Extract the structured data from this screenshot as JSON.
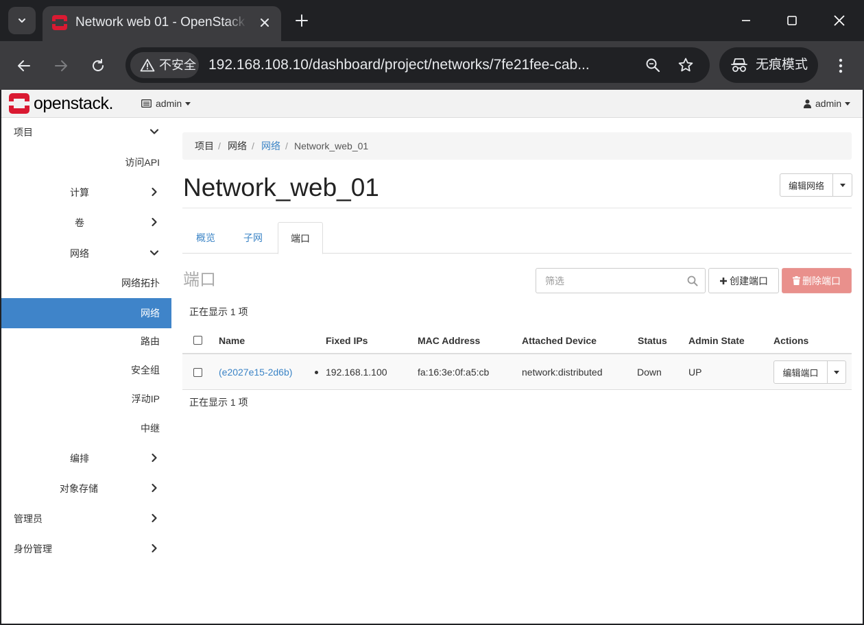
{
  "browser": {
    "tab_title": "Network web 01 - OpenStack",
    "security_label": "不安全",
    "url": "192.168.108.10/dashboard/project/networks/7fe21fee-cab...",
    "incognito_label": "无痕模式"
  },
  "topbar": {
    "brand": "openstack.",
    "project_name": "admin",
    "user_name": "admin"
  },
  "sidebar": {
    "items": [
      {
        "label": "项目"
      },
      {
        "label": "访问API"
      },
      {
        "label": "计算"
      },
      {
        "label": "卷"
      },
      {
        "label": "网络"
      },
      {
        "label": "网络拓扑"
      },
      {
        "label": "网络"
      },
      {
        "label": "路由"
      },
      {
        "label": "安全组"
      },
      {
        "label": "浮动IP"
      },
      {
        "label": "中继"
      },
      {
        "label": "编排"
      },
      {
        "label": "对象存储"
      },
      {
        "label": "管理员"
      },
      {
        "label": "身份管理"
      }
    ]
  },
  "breadcrumb": {
    "items": [
      "项目",
      "网络",
      "网络",
      "Network_web_01"
    ],
    "separator": "/"
  },
  "page": {
    "title": "Network_web_01",
    "edit_network_label": "编辑网络"
  },
  "tabs": [
    {
      "label": "概览"
    },
    {
      "label": "子网"
    },
    {
      "label": "端口"
    }
  ],
  "ports": {
    "section_title": "端口",
    "filter_placeholder": "筛选",
    "create_label": "创建端口",
    "delete_label": "删除端口",
    "count_top": "正在显示 1 项",
    "count_bottom": "正在显示 1 项",
    "columns": [
      "Name",
      "Fixed IPs",
      "MAC Address",
      "Attached Device",
      "Status",
      "Admin State",
      "Actions"
    ],
    "rows": [
      {
        "name": "(e2027e15-2d6b)",
        "fixed_ip": "192.168.1.100",
        "mac": "fa:16:3e:0f:a5:cb",
        "device": "network:distributed",
        "status": "Down",
        "admin_state": "UP",
        "action_label": "编辑端口"
      }
    ]
  },
  "colors": {
    "accent": "#3f84c9",
    "link": "#3b84c6",
    "danger": "#e9908c",
    "brand_red": "#da1a32"
  }
}
